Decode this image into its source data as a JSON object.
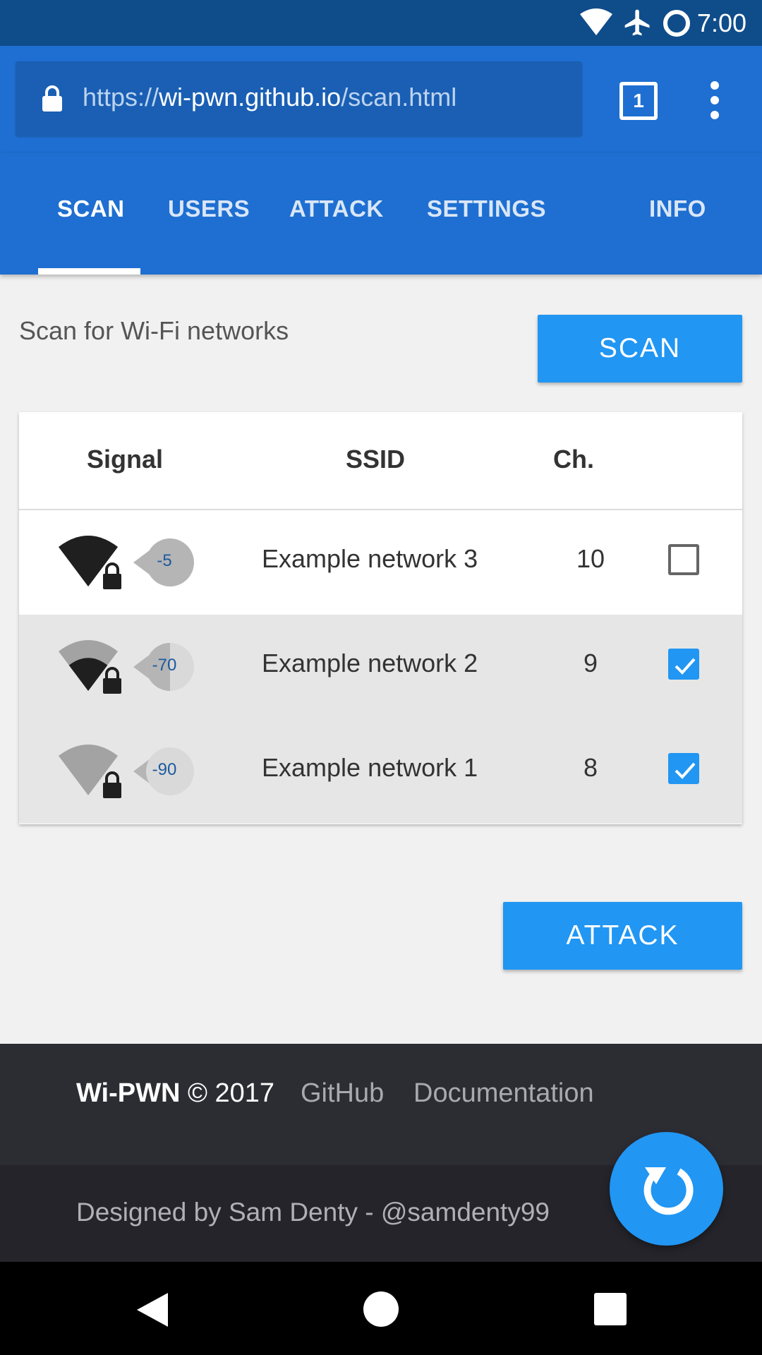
{
  "status_bar": {
    "time": "7:00"
  },
  "browser": {
    "url_scheme": "https://",
    "url_host": "wi-pwn.github.io",
    "url_path": "/scan.html",
    "tab_count": "1"
  },
  "tabs": [
    {
      "label": "SCAN",
      "active": true
    },
    {
      "label": "USERS"
    },
    {
      "label": "ATTACK"
    },
    {
      "label": "SETTINGS"
    },
    {
      "label": "INFO"
    }
  ],
  "scan": {
    "label": "Scan for Wi-Fi networks",
    "button": "SCAN"
  },
  "table": {
    "headers": {
      "signal": "Signal",
      "ssid": "SSID",
      "channel": "Ch."
    },
    "rows": [
      {
        "rssi": "-5",
        "ssid": "Example network 3",
        "channel": "10",
        "checked": false,
        "signal_level": 1.0,
        "locked": true
      },
      {
        "rssi": "-70",
        "ssid": "Example network 2",
        "channel": "9",
        "checked": true,
        "signal_level": 0.5,
        "locked": true
      },
      {
        "rssi": "-90",
        "ssid": "Example network 1",
        "channel": "8",
        "checked": true,
        "signal_level": 0.0,
        "locked": true
      }
    ]
  },
  "attack_button": "ATTACK",
  "footer": {
    "brand": "Wi-PWN",
    "copyright": "© 2017",
    "links": [
      "GitHub",
      "Documentation"
    ],
    "designed_by": "Designed by Sam Denty - @samdenty99"
  },
  "colors": {
    "primary": "#1e6fd1",
    "accent": "#2196f3",
    "status_bar": "#0f4c8a",
    "footer": "#2c2c33"
  },
  "icons": {
    "status": [
      "wifi-icon",
      "airplane-icon",
      "circle-icon"
    ],
    "fab": "refresh-icon",
    "nav": [
      "back-icon",
      "home-icon",
      "recents-icon"
    ]
  }
}
